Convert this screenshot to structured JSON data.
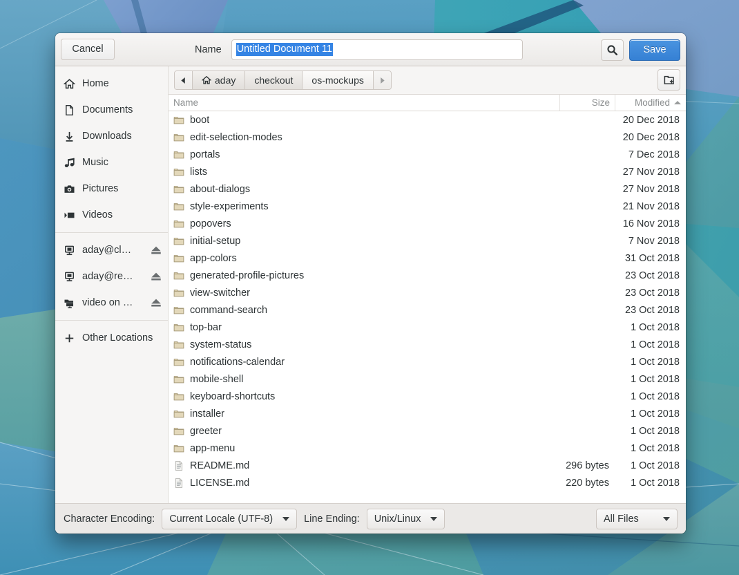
{
  "desktop": {
    "wallpaper_name": "geometric-blue-facets"
  },
  "header": {
    "cancel_label": "Cancel",
    "name_label": "Name",
    "filename_value": "Untitled Document 11",
    "filename_placeholder": "Name",
    "search_icon": "search-icon",
    "save_label": "Save"
  },
  "sidebar": {
    "places": [
      {
        "label": "Home",
        "icon": "home-icon"
      },
      {
        "label": "Documents",
        "icon": "document-icon"
      },
      {
        "label": "Downloads",
        "icon": "download-icon"
      },
      {
        "label": "Music",
        "icon": "music-note-icon"
      },
      {
        "label": "Pictures",
        "icon": "camera-icon"
      },
      {
        "label": "Videos",
        "icon": "film-icon"
      }
    ],
    "mounts": [
      {
        "label": "aday@cl…",
        "icon": "remote-drive-icon",
        "eject": "eject-icon"
      },
      {
        "label": "aday@re…",
        "icon": "remote-drive-icon",
        "eject": "eject-icon"
      },
      {
        "label": "video on …",
        "icon": "network-folder-icon",
        "eject": "eject-icon"
      }
    ],
    "other_locations": {
      "label": "Other Locations",
      "icon": "plus-icon"
    }
  },
  "pathbar": {
    "back_icon": "chevron-left-icon",
    "forward_icon": "chevron-right-icon",
    "crumbs": [
      {
        "label": "aday",
        "icon": "home-icon",
        "active": false
      },
      {
        "label": "checkout",
        "icon": "",
        "active": false
      },
      {
        "label": "os-mockups",
        "icon": "",
        "active": true
      }
    ],
    "new_folder_icon": "new-folder-icon"
  },
  "filelist": {
    "columns": [
      "Name",
      "Size",
      "Modified"
    ],
    "sort_column": "Modified",
    "sort_direction": "ascending",
    "rows": [
      {
        "name": "boot",
        "icon": "folder-icon",
        "size": "",
        "modified": "20 Dec 2018"
      },
      {
        "name": "edit-selection-modes",
        "icon": "folder-icon",
        "size": "",
        "modified": "20 Dec 2018"
      },
      {
        "name": "portals",
        "icon": "folder-icon",
        "size": "",
        "modified": "7 Dec 2018"
      },
      {
        "name": "lists",
        "icon": "folder-icon",
        "size": "",
        "modified": "27 Nov 2018"
      },
      {
        "name": "about-dialogs",
        "icon": "folder-icon",
        "size": "",
        "modified": "27 Nov 2018"
      },
      {
        "name": "style-experiments",
        "icon": "folder-icon",
        "size": "",
        "modified": "21 Nov 2018"
      },
      {
        "name": "popovers",
        "icon": "folder-icon",
        "size": "",
        "modified": "16 Nov 2018"
      },
      {
        "name": "initial-setup",
        "icon": "folder-icon",
        "size": "",
        "modified": "7 Nov 2018"
      },
      {
        "name": "app-colors",
        "icon": "folder-icon",
        "size": "",
        "modified": "31 Oct 2018"
      },
      {
        "name": "generated-profile-pictures",
        "icon": "folder-icon",
        "size": "",
        "modified": "23 Oct 2018"
      },
      {
        "name": "view-switcher",
        "icon": "folder-icon",
        "size": "",
        "modified": "23 Oct 2018"
      },
      {
        "name": "command-search",
        "icon": "folder-icon",
        "size": "",
        "modified": "23 Oct 2018"
      },
      {
        "name": "top-bar",
        "icon": "folder-icon",
        "size": "",
        "modified": "1 Oct 2018"
      },
      {
        "name": "system-status",
        "icon": "folder-icon",
        "size": "",
        "modified": "1 Oct 2018"
      },
      {
        "name": "notifications-calendar",
        "icon": "folder-icon",
        "size": "",
        "modified": "1 Oct 2018"
      },
      {
        "name": "mobile-shell",
        "icon": "folder-icon",
        "size": "",
        "modified": "1 Oct 2018"
      },
      {
        "name": "keyboard-shortcuts",
        "icon": "folder-icon",
        "size": "",
        "modified": "1 Oct 2018"
      },
      {
        "name": "installer",
        "icon": "folder-icon",
        "size": "",
        "modified": "1 Oct 2018"
      },
      {
        "name": "greeter",
        "icon": "folder-icon",
        "size": "",
        "modified": "1 Oct 2018"
      },
      {
        "name": "app-menu",
        "icon": "folder-icon",
        "size": "",
        "modified": "1 Oct 2018"
      },
      {
        "name": "README.md",
        "icon": "text-file-icon",
        "size": "296 bytes",
        "modified": "1 Oct 2018"
      },
      {
        "name": "LICENSE.md",
        "icon": "text-file-icon",
        "size": "220 bytes",
        "modified": "1 Oct 2018"
      }
    ]
  },
  "actionbar": {
    "encoding_label": "Character Encoding:",
    "encoding_value": "Current Locale (UTF-8)",
    "line_ending_label": "Line Ending:",
    "line_ending_value": "Unix/Linux",
    "filter_value": "All Files"
  },
  "colors": {
    "accent": "#3584e4",
    "save_button": "#3580d4",
    "selection": "#3584e4",
    "folder_icon": "#d6c9a6",
    "dialog_bg": "#f6f5f4",
    "list_bg": "#ffffff"
  }
}
